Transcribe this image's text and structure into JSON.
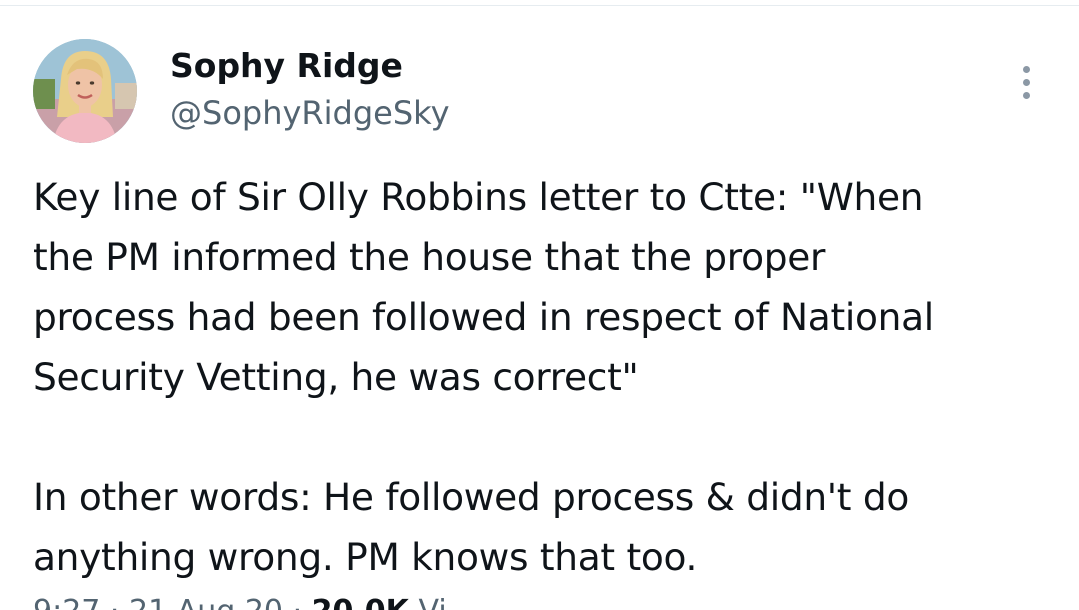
{
  "author": {
    "display_name": "Sophy Ridge",
    "handle": "@SophyRidgeSky",
    "avatar_icon": "profile-photo"
  },
  "tweet": {
    "lines": [
      "Key line of Sir Olly Robbins letter to Ctte: \"When",
      "the PM informed the house that the proper",
      "process had been followed in respect of National",
      "Security Vetting, he was correct\""
    ],
    "lines_2": [
      "In other words: He followed process & didn't do",
      "anything wrong. PM knows that too."
    ]
  },
  "meta": {
    "time": "9:27",
    "separator": "·",
    "date": "21 Aug 20",
    "views_count": "20.0K",
    "views_label": "Vi"
  },
  "icons": {
    "more": "more-vertical-icon"
  },
  "colors": {
    "text": "#0f1419",
    "secondary": "#536471",
    "divider": "#e6ecf0"
  }
}
